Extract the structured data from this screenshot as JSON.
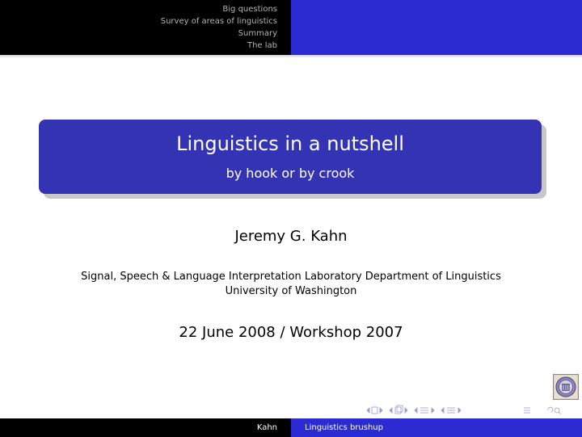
{
  "headline": {
    "sections": [
      "Big questions",
      "Survey of areas of linguistics",
      "Summary",
      "The lab"
    ]
  },
  "title_block": {
    "title": "Linguistics in a nutshell",
    "subtitle": "by hook or by crook"
  },
  "author": "Jeremy G. Kahn",
  "institute": {
    "line1": "Signal, Speech & Language Interpretation Laboratory Department of Linguistics",
    "line2": "University of Washington"
  },
  "date": "22 June 2008 / Workshop 2007",
  "footline": {
    "author": "Kahn",
    "short_title": "Linguistics brushup"
  },
  "navigation": {
    "icons": [
      "first-frame-icon",
      "slide-icon",
      "subsection-icon",
      "section-icon",
      "document-icon",
      "search-icon"
    ]
  },
  "colors": {
    "headline_left": "#000000",
    "headline_right": "#2b2bd1",
    "title_box": "#3333b3",
    "section_text": "#b3b3b3",
    "nav_symbols": "#9a9ad6"
  },
  "logo": {
    "icon": "university-seal-icon"
  }
}
